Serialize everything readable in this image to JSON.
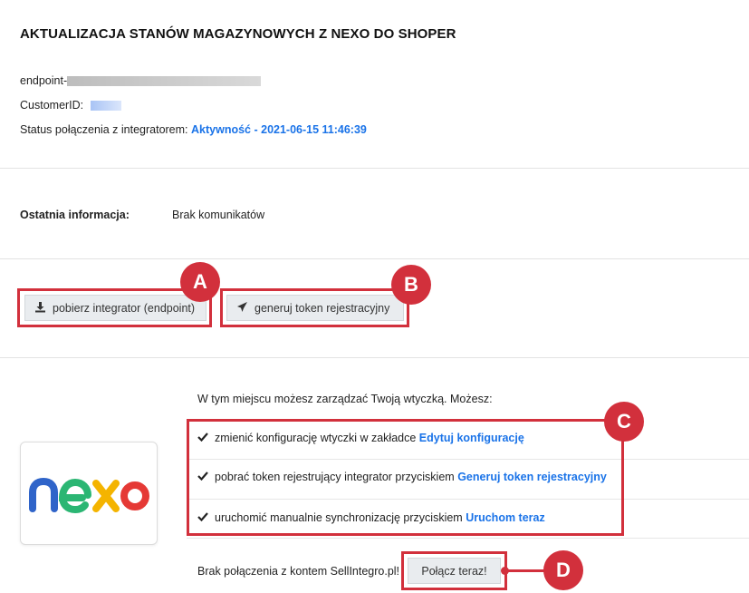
{
  "header": {
    "title": "AKTUALIZACJA STANÓW MAGAZYNOWYCH Z NEXO DO SHOPER"
  },
  "info": {
    "endpoint_label": "endpoint-",
    "customer_label": "CustomerID:",
    "status_label": "Status połączenia z integratorem:",
    "status_value": "Aktywność - 2021-06-15 11:46:39"
  },
  "last_info": {
    "label": "Ostatnia informacja:",
    "value": "Brak komunikatów"
  },
  "buttons": {
    "download_label": "pobierz integrator (endpoint)",
    "token_label": "generuj token rejestracyjny",
    "connect_label": "Połącz teraz!"
  },
  "plugin": {
    "intro": "W tym miejscu możesz zarządzać Twoją wtyczką. Możesz:",
    "items": [
      {
        "text": "zmienić konfigurację wtyczki w zakładce",
        "link": "Edytuj konfigurację"
      },
      {
        "text": "pobrać token rejestrujący integrator przyciskiem",
        "link": "Generuj token rejestracyjny"
      },
      {
        "text": "uruchomić manualnie synchronizację przyciskiem",
        "link": "Uruchom teraz"
      }
    ],
    "no_connection": "Brak połączenia z kontem SellIntegro.pl!"
  },
  "logo": {
    "text": "nexo",
    "colors": [
      "#2f64c9",
      "#2bb673",
      "#f4b400",
      "#e53935"
    ]
  },
  "annotations": [
    "A",
    "B",
    "C",
    "D"
  ],
  "colors": {
    "accent": "#d2303c",
    "link": "#1a73e8"
  }
}
